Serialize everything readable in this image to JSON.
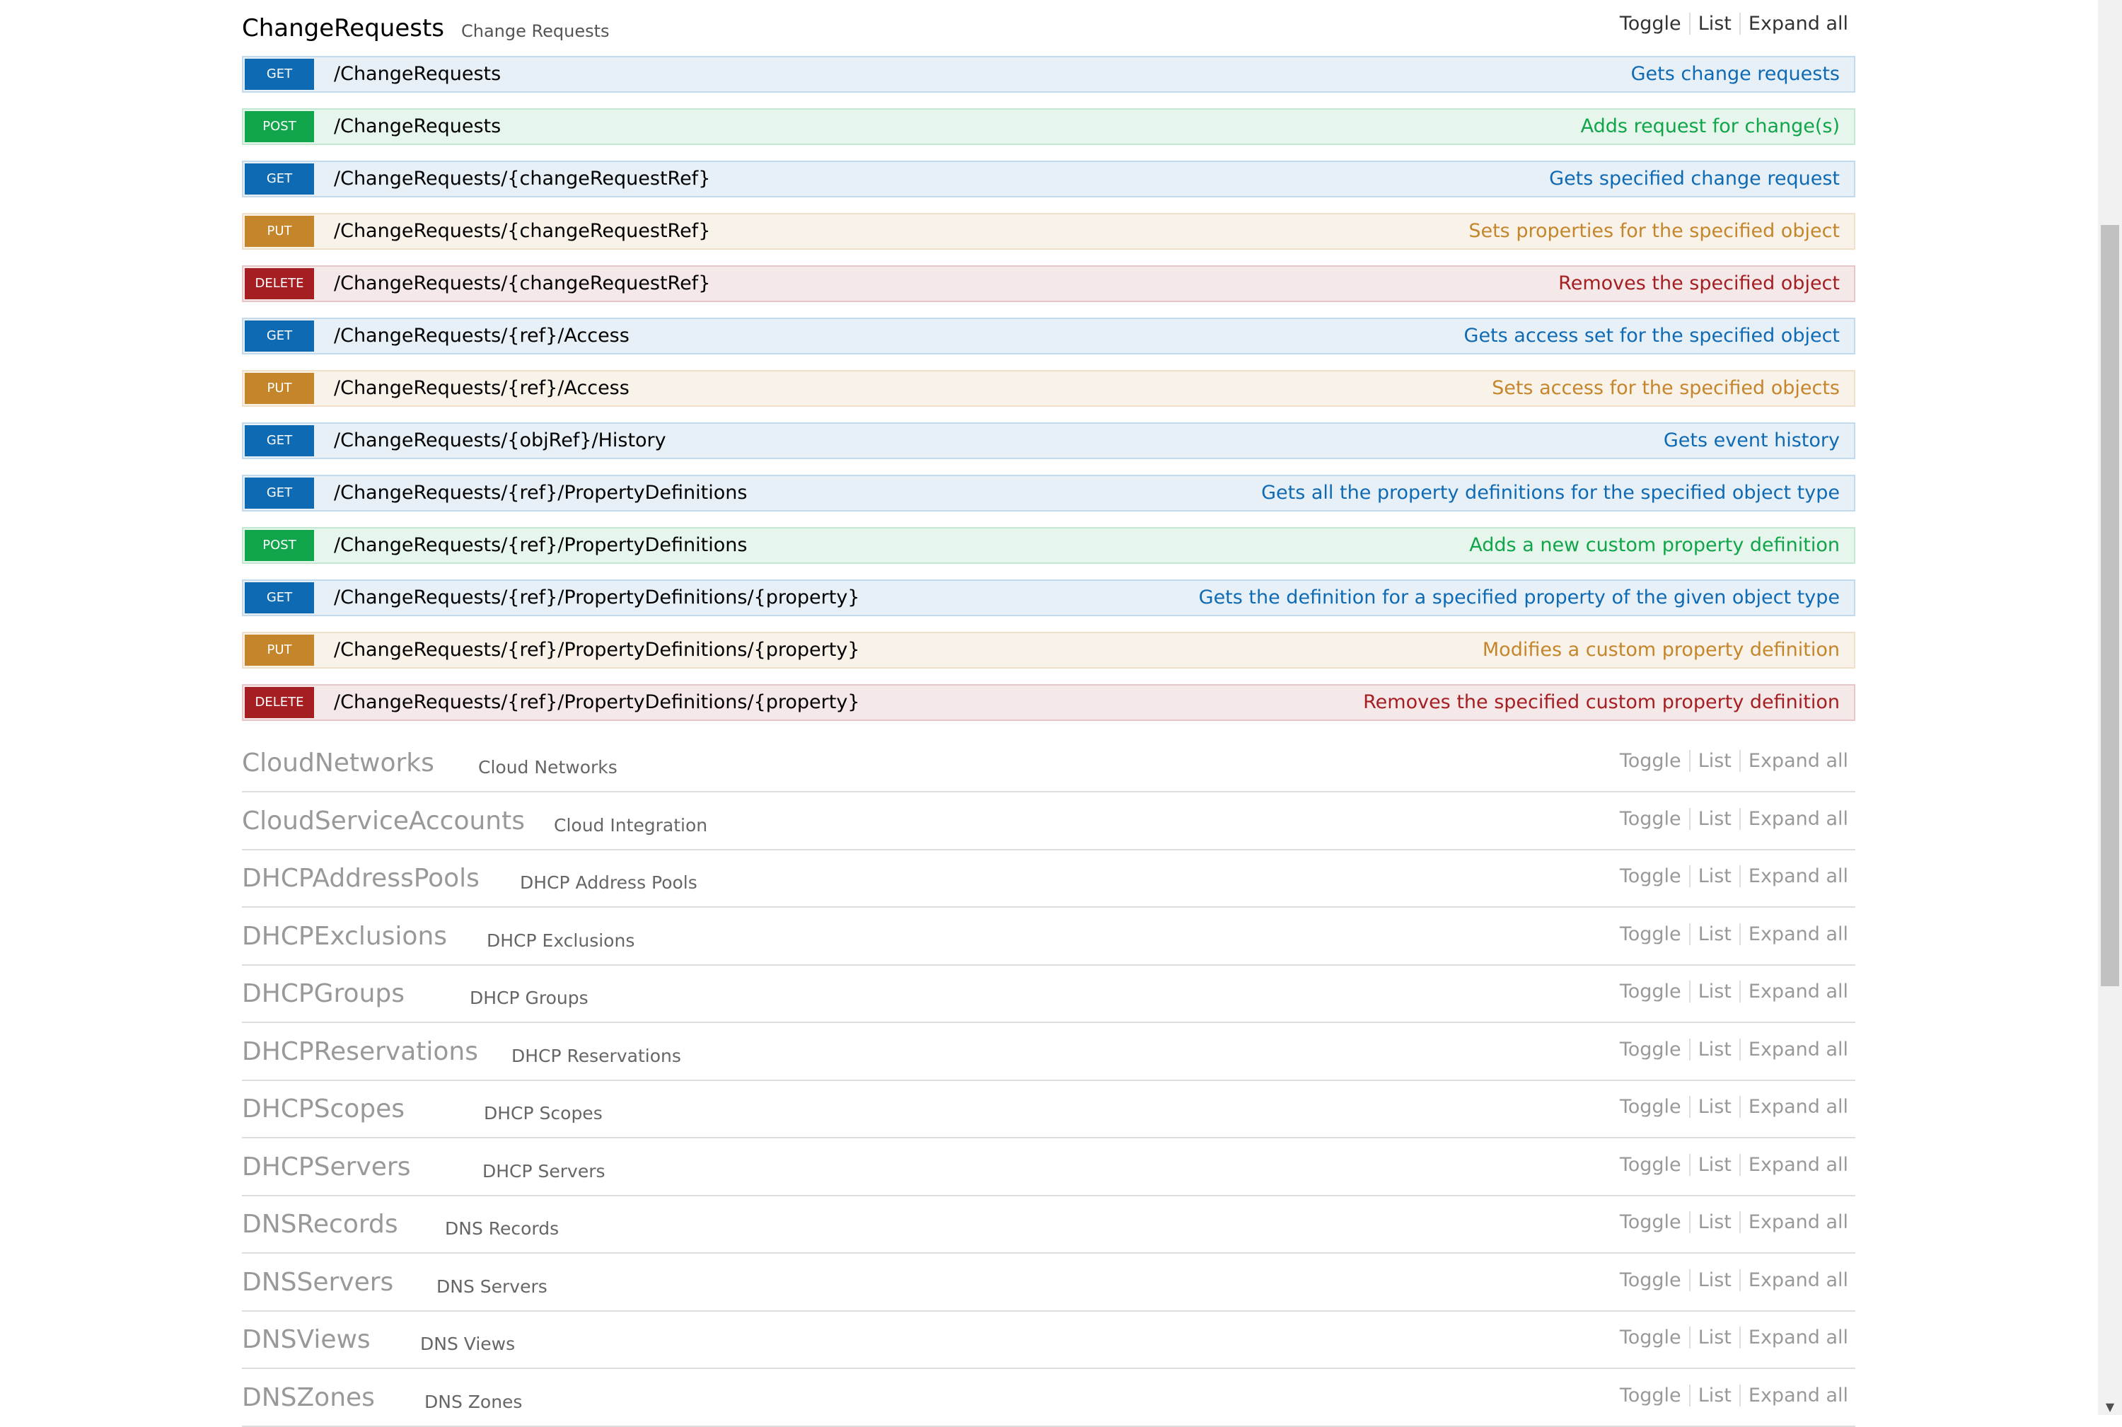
{
  "current_resource": {
    "name": "ChangeRequests",
    "description": "Change Requests",
    "links": [
      "Toggle",
      "List",
      "Expand all"
    ]
  },
  "operations": [
    {
      "method": "GET",
      "path": "/ChangeRequests",
      "summary": "Gets change requests"
    },
    {
      "method": "POST",
      "path": "/ChangeRequests",
      "summary": "Adds request for change(s)"
    },
    {
      "method": "GET",
      "path": "/ChangeRequests/{changeRequestRef}",
      "summary": "Gets specified change request"
    },
    {
      "method": "PUT",
      "path": "/ChangeRequests/{changeRequestRef}",
      "summary": "Sets properties for the specified object"
    },
    {
      "method": "DELETE",
      "path": "/ChangeRequests/{changeRequestRef}",
      "summary": "Removes the specified object"
    },
    {
      "method": "GET",
      "path": "/ChangeRequests/{ref}/Access",
      "summary": "Gets access set for the specified object"
    },
    {
      "method": "PUT",
      "path": "/ChangeRequests/{ref}/Access",
      "summary": "Sets access for the specified objects"
    },
    {
      "method": "GET",
      "path": "/ChangeRequests/{objRef}/History",
      "summary": "Gets event history"
    },
    {
      "method": "GET",
      "path": "/ChangeRequests/{ref}/PropertyDefinitions",
      "summary": "Gets all the property definitions for the specified object type"
    },
    {
      "method": "POST",
      "path": "/ChangeRequests/{ref}/PropertyDefinitions",
      "summary": "Adds a new custom property definition"
    },
    {
      "method": "GET",
      "path": "/ChangeRequests/{ref}/PropertyDefinitions/{property}",
      "summary": "Gets the definition for a specified property of the given object type"
    },
    {
      "method": "PUT",
      "path": "/ChangeRequests/{ref}/PropertyDefinitions/{property}",
      "summary": "Modifies a custom property definition"
    },
    {
      "method": "DELETE",
      "path": "/ChangeRequests/{ref}/PropertyDefinitions/{property}",
      "summary": "Removes the specified custom property definition"
    }
  ],
  "resources": [
    {
      "name": "CloudNetworks",
      "description": "Cloud Networks"
    },
    {
      "name": "CloudServiceAccounts",
      "description": "Cloud Integration"
    },
    {
      "name": "DHCPAddressPools",
      "description": "DHCP Address Pools"
    },
    {
      "name": "DHCPExclusions",
      "description": "DHCP Exclusions"
    },
    {
      "name": "DHCPGroups",
      "description": "DHCP Groups"
    },
    {
      "name": "DHCPReservations",
      "description": "DHCP Reservations"
    },
    {
      "name": "DHCPScopes",
      "description": "DHCP Scopes"
    },
    {
      "name": "DHCPServers",
      "description": "DHCP Servers"
    },
    {
      "name": "DNSRecords",
      "description": "DNS Records"
    },
    {
      "name": "DNSServers",
      "description": "DNS Servers"
    },
    {
      "name": "DNSViews",
      "description": "DNS Views"
    },
    {
      "name": "DNSZones",
      "description": "DNS Zones"
    }
  ],
  "resource_links": [
    "Toggle",
    "List",
    "Expand all"
  ],
  "icons": {
    "scroll_down": "triangle-down-icon"
  },
  "colors": {
    "get": "#0f6ab4",
    "post": "#10a54a",
    "put": "#c5862b",
    "delete": "#a41e22"
  }
}
